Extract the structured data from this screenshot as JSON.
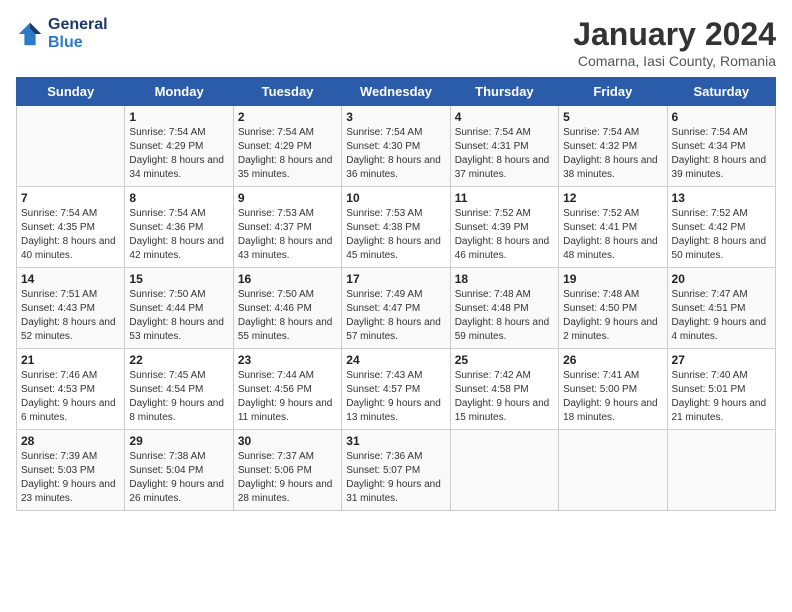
{
  "logo": {
    "line1": "General",
    "line2": "Blue"
  },
  "title": "January 2024",
  "subtitle": "Comarna, Iasi County, Romania",
  "days_header": [
    "Sunday",
    "Monday",
    "Tuesday",
    "Wednesday",
    "Thursday",
    "Friday",
    "Saturday"
  ],
  "weeks": [
    [
      {
        "day": "",
        "sunrise": "",
        "sunset": "",
        "daylight": ""
      },
      {
        "day": "1",
        "sunrise": "Sunrise: 7:54 AM",
        "sunset": "Sunset: 4:29 PM",
        "daylight": "Daylight: 8 hours and 34 minutes."
      },
      {
        "day": "2",
        "sunrise": "Sunrise: 7:54 AM",
        "sunset": "Sunset: 4:29 PM",
        "daylight": "Daylight: 8 hours and 35 minutes."
      },
      {
        "day": "3",
        "sunrise": "Sunrise: 7:54 AM",
        "sunset": "Sunset: 4:30 PM",
        "daylight": "Daylight: 8 hours and 36 minutes."
      },
      {
        "day": "4",
        "sunrise": "Sunrise: 7:54 AM",
        "sunset": "Sunset: 4:31 PM",
        "daylight": "Daylight: 8 hours and 37 minutes."
      },
      {
        "day": "5",
        "sunrise": "Sunrise: 7:54 AM",
        "sunset": "Sunset: 4:32 PM",
        "daylight": "Daylight: 8 hours and 38 minutes."
      },
      {
        "day": "6",
        "sunrise": "Sunrise: 7:54 AM",
        "sunset": "Sunset: 4:34 PM",
        "daylight": "Daylight: 8 hours and 39 minutes."
      }
    ],
    [
      {
        "day": "7",
        "sunrise": "Sunrise: 7:54 AM",
        "sunset": "Sunset: 4:35 PM",
        "daylight": "Daylight: 8 hours and 40 minutes."
      },
      {
        "day": "8",
        "sunrise": "Sunrise: 7:54 AM",
        "sunset": "Sunset: 4:36 PM",
        "daylight": "Daylight: 8 hours and 42 minutes."
      },
      {
        "day": "9",
        "sunrise": "Sunrise: 7:53 AM",
        "sunset": "Sunset: 4:37 PM",
        "daylight": "Daylight: 8 hours and 43 minutes."
      },
      {
        "day": "10",
        "sunrise": "Sunrise: 7:53 AM",
        "sunset": "Sunset: 4:38 PM",
        "daylight": "Daylight: 8 hours and 45 minutes."
      },
      {
        "day": "11",
        "sunrise": "Sunrise: 7:52 AM",
        "sunset": "Sunset: 4:39 PM",
        "daylight": "Daylight: 8 hours and 46 minutes."
      },
      {
        "day": "12",
        "sunrise": "Sunrise: 7:52 AM",
        "sunset": "Sunset: 4:41 PM",
        "daylight": "Daylight: 8 hours and 48 minutes."
      },
      {
        "day": "13",
        "sunrise": "Sunrise: 7:52 AM",
        "sunset": "Sunset: 4:42 PM",
        "daylight": "Daylight: 8 hours and 50 minutes."
      }
    ],
    [
      {
        "day": "14",
        "sunrise": "Sunrise: 7:51 AM",
        "sunset": "Sunset: 4:43 PM",
        "daylight": "Daylight: 8 hours and 52 minutes."
      },
      {
        "day": "15",
        "sunrise": "Sunrise: 7:50 AM",
        "sunset": "Sunset: 4:44 PM",
        "daylight": "Daylight: 8 hours and 53 minutes."
      },
      {
        "day": "16",
        "sunrise": "Sunrise: 7:50 AM",
        "sunset": "Sunset: 4:46 PM",
        "daylight": "Daylight: 8 hours and 55 minutes."
      },
      {
        "day": "17",
        "sunrise": "Sunrise: 7:49 AM",
        "sunset": "Sunset: 4:47 PM",
        "daylight": "Daylight: 8 hours and 57 minutes."
      },
      {
        "day": "18",
        "sunrise": "Sunrise: 7:48 AM",
        "sunset": "Sunset: 4:48 PM",
        "daylight": "Daylight: 8 hours and 59 minutes."
      },
      {
        "day": "19",
        "sunrise": "Sunrise: 7:48 AM",
        "sunset": "Sunset: 4:50 PM",
        "daylight": "Daylight: 9 hours and 2 minutes."
      },
      {
        "day": "20",
        "sunrise": "Sunrise: 7:47 AM",
        "sunset": "Sunset: 4:51 PM",
        "daylight": "Daylight: 9 hours and 4 minutes."
      }
    ],
    [
      {
        "day": "21",
        "sunrise": "Sunrise: 7:46 AM",
        "sunset": "Sunset: 4:53 PM",
        "daylight": "Daylight: 9 hours and 6 minutes."
      },
      {
        "day": "22",
        "sunrise": "Sunrise: 7:45 AM",
        "sunset": "Sunset: 4:54 PM",
        "daylight": "Daylight: 9 hours and 8 minutes."
      },
      {
        "day": "23",
        "sunrise": "Sunrise: 7:44 AM",
        "sunset": "Sunset: 4:56 PM",
        "daylight": "Daylight: 9 hours and 11 minutes."
      },
      {
        "day": "24",
        "sunrise": "Sunrise: 7:43 AM",
        "sunset": "Sunset: 4:57 PM",
        "daylight": "Daylight: 9 hours and 13 minutes."
      },
      {
        "day": "25",
        "sunrise": "Sunrise: 7:42 AM",
        "sunset": "Sunset: 4:58 PM",
        "daylight": "Daylight: 9 hours and 15 minutes."
      },
      {
        "day": "26",
        "sunrise": "Sunrise: 7:41 AM",
        "sunset": "Sunset: 5:00 PM",
        "daylight": "Daylight: 9 hours and 18 minutes."
      },
      {
        "day": "27",
        "sunrise": "Sunrise: 7:40 AM",
        "sunset": "Sunset: 5:01 PM",
        "daylight": "Daylight: 9 hours and 21 minutes."
      }
    ],
    [
      {
        "day": "28",
        "sunrise": "Sunrise: 7:39 AM",
        "sunset": "Sunset: 5:03 PM",
        "daylight": "Daylight: 9 hours and 23 minutes."
      },
      {
        "day": "29",
        "sunrise": "Sunrise: 7:38 AM",
        "sunset": "Sunset: 5:04 PM",
        "daylight": "Daylight: 9 hours and 26 minutes."
      },
      {
        "day": "30",
        "sunrise": "Sunrise: 7:37 AM",
        "sunset": "Sunset: 5:06 PM",
        "daylight": "Daylight: 9 hours and 28 minutes."
      },
      {
        "day": "31",
        "sunrise": "Sunrise: 7:36 AM",
        "sunset": "Sunset: 5:07 PM",
        "daylight": "Daylight: 9 hours and 31 minutes."
      },
      {
        "day": "",
        "sunrise": "",
        "sunset": "",
        "daylight": ""
      },
      {
        "day": "",
        "sunrise": "",
        "sunset": "",
        "daylight": ""
      },
      {
        "day": "",
        "sunrise": "",
        "sunset": "",
        "daylight": ""
      }
    ]
  ]
}
